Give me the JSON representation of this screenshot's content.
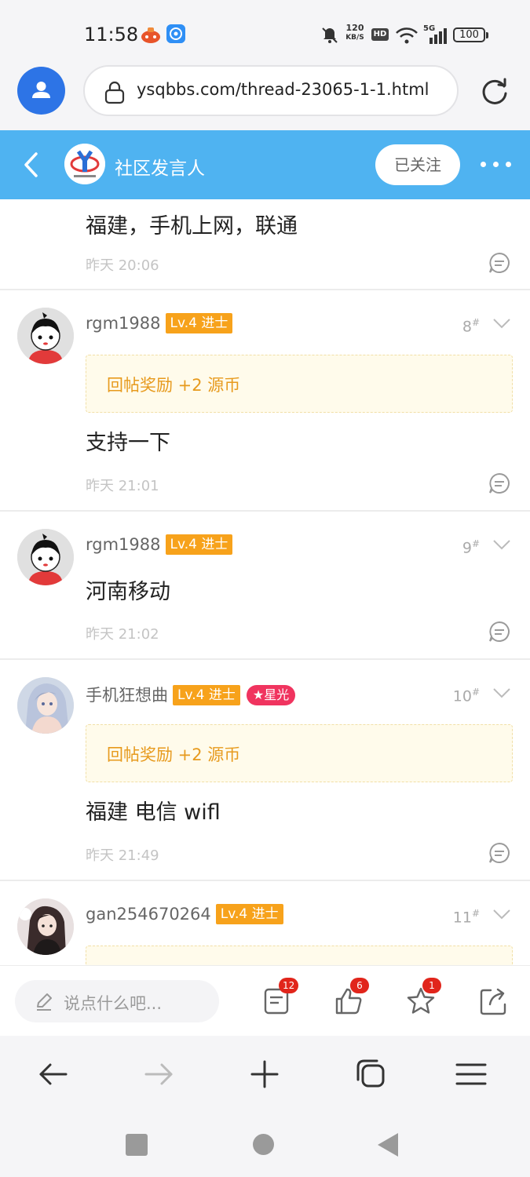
{
  "status_bar": {
    "time": "11:58",
    "net_speed_value": "120",
    "net_speed_unit": "KB/S",
    "hd_label": "HD",
    "network_label": "5G",
    "battery": "100"
  },
  "browser": {
    "url": "ysqbbs.com/thread-23065-1-1.html"
  },
  "forum_header": {
    "name": "社区发言人",
    "follow_label": "已关注",
    "accent": "#4fb3f1"
  },
  "posts": [
    {
      "content": "福建，手机上网，联通",
      "time": "昨天 20:06"
    },
    {
      "username": "rgm1988",
      "level": "Lv.4 进士",
      "floor": "8",
      "reward": "回帖奖励 +2 源币",
      "content": "支持一下",
      "time": "昨天 21:01"
    },
    {
      "username": "rgm1988",
      "level": "Lv.4 进士",
      "floor": "9",
      "content": "河南移动",
      "time": "昨天 21:02"
    },
    {
      "username": "手机狂想曲",
      "level": "Lv.4 进士",
      "badge": "★星光",
      "floor": "10",
      "reward": "回帖奖励 +2 源币",
      "content": "福建 电信 wifl",
      "time": "昨天 21:49"
    },
    {
      "username": "gan254670264",
      "level": "Lv.4 进士",
      "floor": "11"
    }
  ],
  "floor_mark": "#",
  "action_bar": {
    "reply_placeholder": "说点什么吧...",
    "comments_count": "12",
    "likes_count": "6",
    "favorites_count": "1"
  },
  "colors": {
    "level_badge": "#f7a21b",
    "star_badge": "#f0345f",
    "reward_text": "#e79a1d",
    "notification_badge": "#e1251b"
  }
}
